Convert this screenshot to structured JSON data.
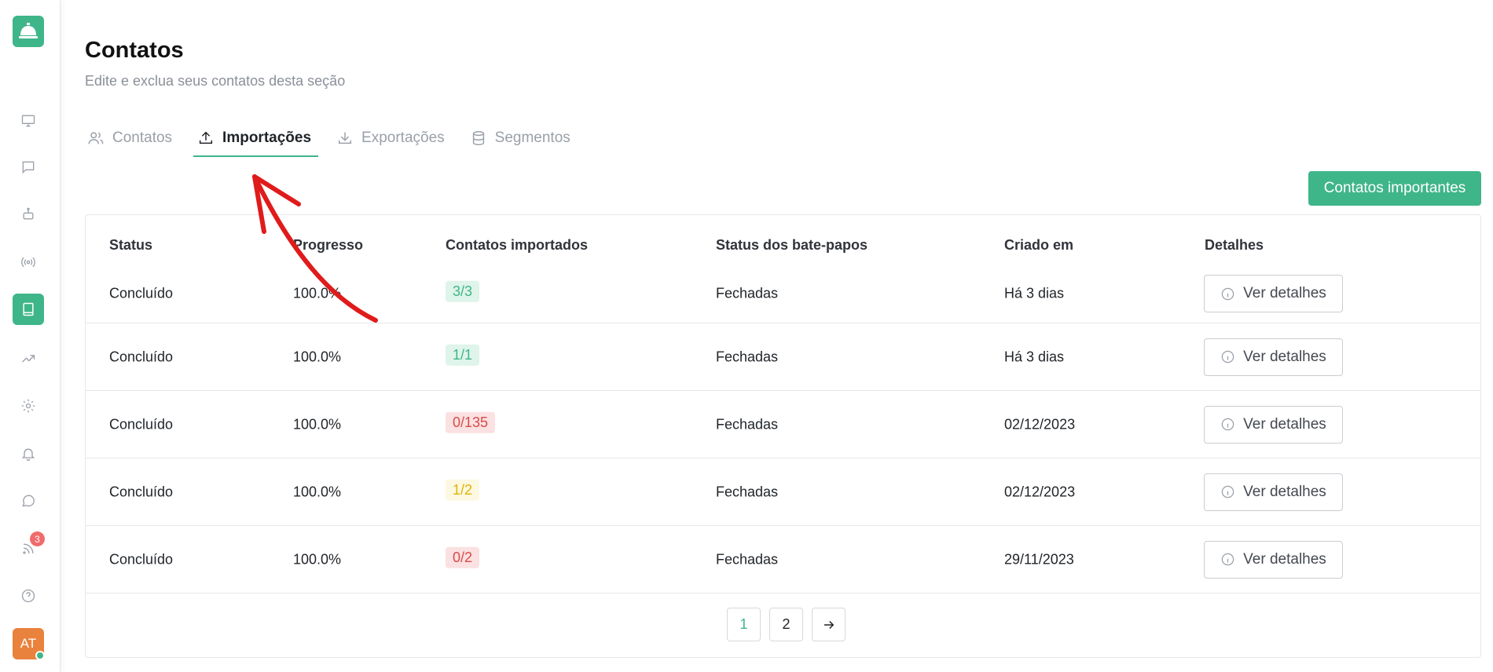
{
  "header": {
    "title": "Contatos",
    "subtitle": "Edite e exclua seus contatos desta seção"
  },
  "tabs": [
    {
      "label": "Contatos",
      "icon": "users-icon",
      "active": false
    },
    {
      "label": "Importações",
      "icon": "upload-icon",
      "active": true
    },
    {
      "label": "Exportações",
      "icon": "download-icon",
      "active": false
    },
    {
      "label": "Segmentos",
      "icon": "database-icon",
      "active": false
    }
  ],
  "actions": {
    "import_button": "Contatos importantes"
  },
  "table": {
    "headers": {
      "status": "Status",
      "progress": "Progresso",
      "imported": "Contatos importados",
      "chat_status": "Status dos bate-papos",
      "created": "Criado em",
      "details": "Detalhes"
    },
    "rows": [
      {
        "status": "Concluído",
        "progress": "100.0%",
        "imported": "3/3",
        "imported_color": "green",
        "chat_status": "Fechadas",
        "created": "Há 3 dias",
        "details": "Ver detalhes"
      },
      {
        "status": "Concluído",
        "progress": "100.0%",
        "imported": "1/1",
        "imported_color": "green",
        "chat_status": "Fechadas",
        "created": "Há 3 dias",
        "details": "Ver detalhes"
      },
      {
        "status": "Concluído",
        "progress": "100.0%",
        "imported": "0/135",
        "imported_color": "red",
        "chat_status": "Fechadas",
        "created": "02/12/2023",
        "details": "Ver detalhes"
      },
      {
        "status": "Concluído",
        "progress": "100.0%",
        "imported": "1/2",
        "imported_color": "yellow",
        "chat_status": "Fechadas",
        "created": "02/12/2023",
        "details": "Ver detalhes"
      },
      {
        "status": "Concluído",
        "progress": "100.0%",
        "imported": "0/2",
        "imported_color": "red",
        "chat_status": "Fechadas",
        "created": "29/11/2023",
        "details": "Ver detalhes"
      }
    ]
  },
  "pagination": {
    "pages": [
      "1",
      "2"
    ],
    "current": "1"
  },
  "sidebar": {
    "logo_icon": "bell-service-icon",
    "notification_count": "3",
    "avatar_initials": "AT"
  },
  "colors": {
    "accent": "#3fb58a",
    "badge": "#f06b6b",
    "avatar": "#e9823c",
    "annotation": "#e01b1b"
  }
}
